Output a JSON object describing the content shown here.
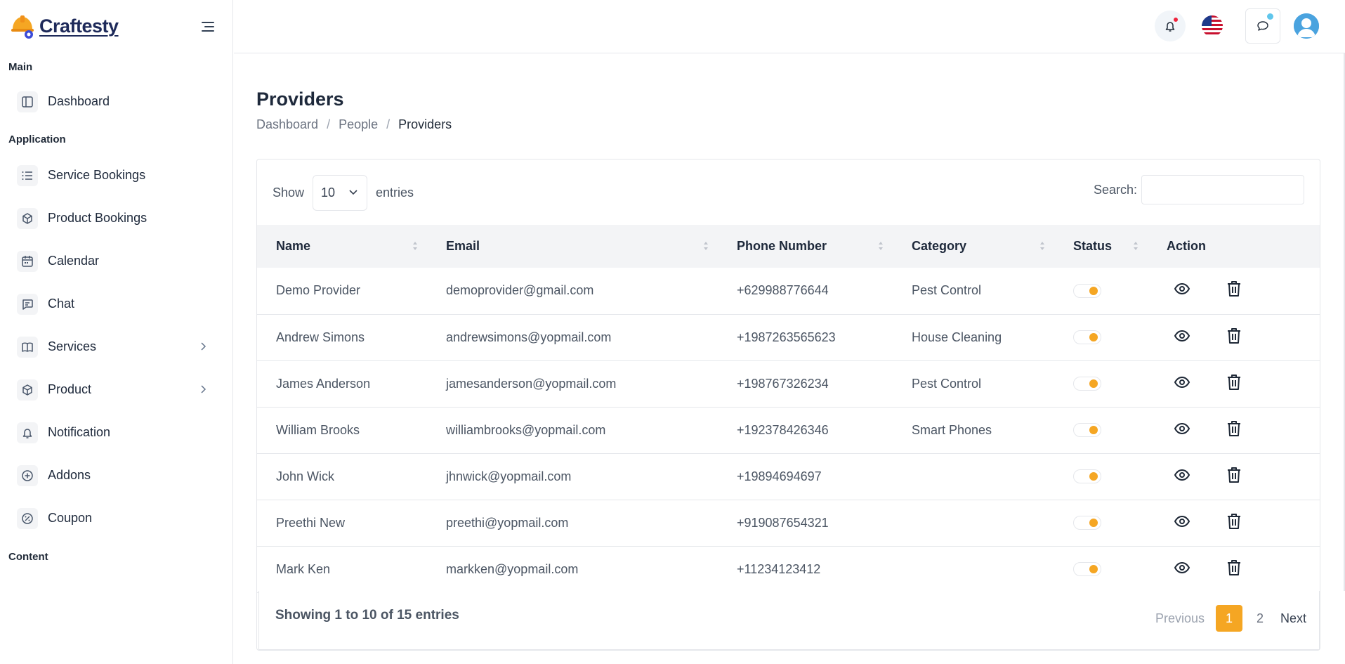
{
  "brand": {
    "name": "Craftesty"
  },
  "sidebar": {
    "sections": {
      "main": "Main",
      "application": "Application",
      "content": "Content"
    },
    "items": [
      {
        "label": "Dashboard",
        "icon": "layout-icon"
      },
      {
        "label": "Service Bookings",
        "icon": "list-icon"
      },
      {
        "label": "Product Bookings",
        "icon": "box-icon"
      },
      {
        "label": "Calendar",
        "icon": "calendar-icon"
      },
      {
        "label": "Chat",
        "icon": "message-icon"
      },
      {
        "label": "Services",
        "icon": "book-icon",
        "has_submenu": true
      },
      {
        "label": "Product",
        "icon": "box-icon",
        "has_submenu": true
      },
      {
        "label": "Notification",
        "icon": "bell-icon"
      },
      {
        "label": "Addons",
        "icon": "plus-circle-icon"
      },
      {
        "label": "Coupon",
        "icon": "percent-icon"
      }
    ]
  },
  "page": {
    "title": "Providers",
    "breadcrumb": [
      "Dashboard",
      "People",
      "Providers"
    ]
  },
  "table_controls": {
    "show_label": "Show",
    "entries_value": "10",
    "entries_label": "entries",
    "search_label": "Search:",
    "search_value": ""
  },
  "table": {
    "columns": [
      "Name",
      "Email",
      "Phone Number",
      "Category",
      "Status",
      "Action"
    ],
    "rows": [
      {
        "name": "Demo Provider",
        "email": "demoprovider@gmail.com",
        "phone": "+629988776644",
        "category": "Pest Control",
        "status": true
      },
      {
        "name": "Andrew Simons",
        "email": "andrewsimons@yopmail.com",
        "phone": "+1987263565623",
        "category": "House Cleaning",
        "status": true
      },
      {
        "name": "James Anderson",
        "email": "jamesanderson@yopmail.com",
        "phone": "+198767326234",
        "category": "Pest Control",
        "status": true
      },
      {
        "name": "William Brooks",
        "email": "williambrooks@yopmail.com",
        "phone": "+192378426346",
        "category": "Smart Phones",
        "status": true
      },
      {
        "name": "John Wick",
        "email": "jhnwick@yopmail.com",
        "phone": "+19894694697",
        "category": "",
        "status": true
      },
      {
        "name": "Preethi New",
        "email": "preethi@yopmail.com",
        "phone": "+919087654321",
        "category": "",
        "status": true
      },
      {
        "name": "Mark Ken",
        "email": "markken@yopmail.com",
        "phone": "+11234123412",
        "category": "",
        "status": true
      }
    ]
  },
  "pagination": {
    "info": "Showing 1 to 10 of 15 entries",
    "previous": "Previous",
    "pages": [
      "1",
      "2"
    ],
    "next": "Next"
  },
  "colors": {
    "accent": "#f5a623",
    "brand_navy": "#1e2a5a"
  }
}
